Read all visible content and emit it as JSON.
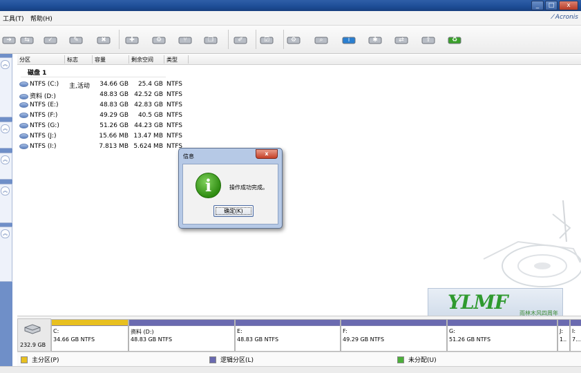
{
  "menu": {
    "tools": "工具(T)",
    "help": "帮助(H)",
    "brand": "Acronis"
  },
  "toolbar_icons": [
    "arrow-icon",
    "swap-icon",
    "check-disk-icon",
    "disk-edit-icon",
    "disk-delete-icon",
    "disk-add-icon",
    "disk-tool-icon",
    "disk-split-icon",
    "disk-copy-icon",
    "brush-icon",
    "checkbox-icon",
    "gear-icon",
    "search-icon",
    "info-icon",
    "disk-star-icon",
    "disk-sync-icon",
    "disk-export-icon",
    "recycle-icon"
  ],
  "table": {
    "headers": [
      "分区",
      "标志",
      "容量",
      "剩余空间",
      "类型"
    ],
    "disk_label": "磁盘 1",
    "rows": [
      {
        "name": "NTFS (C:)",
        "flag": "主,活动",
        "capacity": "34.66 GB",
        "free": "25.4 GB",
        "type": "NTFS"
      },
      {
        "name": "资料 (D:)",
        "flag": "",
        "capacity": "48.83 GB",
        "free": "42.52 GB",
        "type": "NTFS"
      },
      {
        "name": "NTFS (E:)",
        "flag": "",
        "capacity": "48.83 GB",
        "free": "42.83 GB",
        "type": "NTFS"
      },
      {
        "name": "NTFS (F:)",
        "flag": "",
        "capacity": "49.29 GB",
        "free": "40.5 GB",
        "type": "NTFS"
      },
      {
        "name": "NTFS (G:)",
        "flag": "",
        "capacity": "51.26 GB",
        "free": "44.23 GB",
        "type": "NTFS"
      },
      {
        "name": "NTFS (J:)",
        "flag": "",
        "capacity": "15.66 MB",
        "free": "13.47 MB",
        "type": "NTFS"
      },
      {
        "name": "NTFS (I:)",
        "flag": "",
        "capacity": "7.813 MB",
        "free": "5.624 MB",
        "type": "NTFS"
      }
    ]
  },
  "dialog": {
    "title": "信息",
    "close": "x",
    "message": "操作成功完成。",
    "ok": "确定(K)"
  },
  "logo": {
    "mark": "YLMF",
    "text": "雨林木风四周年"
  },
  "disk_map": {
    "size": "232.9 GB",
    "partitions": [
      {
        "label": "C:",
        "size": "34.66 GB  NTFS",
        "color": "#e8c020"
      },
      {
        "label": "资料 (D:)",
        "size": "48.83 GB  NTFS",
        "color": "#6a6ab0"
      },
      {
        "label": "E:",
        "size": "48.83 GB  NTFS",
        "color": "#6a6ab0"
      },
      {
        "label": "F:",
        "size": "49.29 GB  NTFS",
        "color": "#6a6ab0"
      },
      {
        "label": "G:",
        "size": "51.26 GB  NTFS",
        "color": "#6a6ab0"
      },
      {
        "label": "J:",
        "size": "1..",
        "color": "#6a6ab0"
      },
      {
        "label": "I:",
        "size": "7...",
        "color": "#6a6ab0"
      }
    ]
  },
  "legend": {
    "primary": "主分区(P)",
    "logical": "逻辑分区(L)",
    "unallocated": "未分配(U)",
    "primary_color": "#e8c020",
    "logical_color": "#6a6ab0",
    "unallocated_color": "#4caf3a"
  },
  "window_buttons": {
    "minimize": "_",
    "maximize": "□",
    "close": "x"
  }
}
